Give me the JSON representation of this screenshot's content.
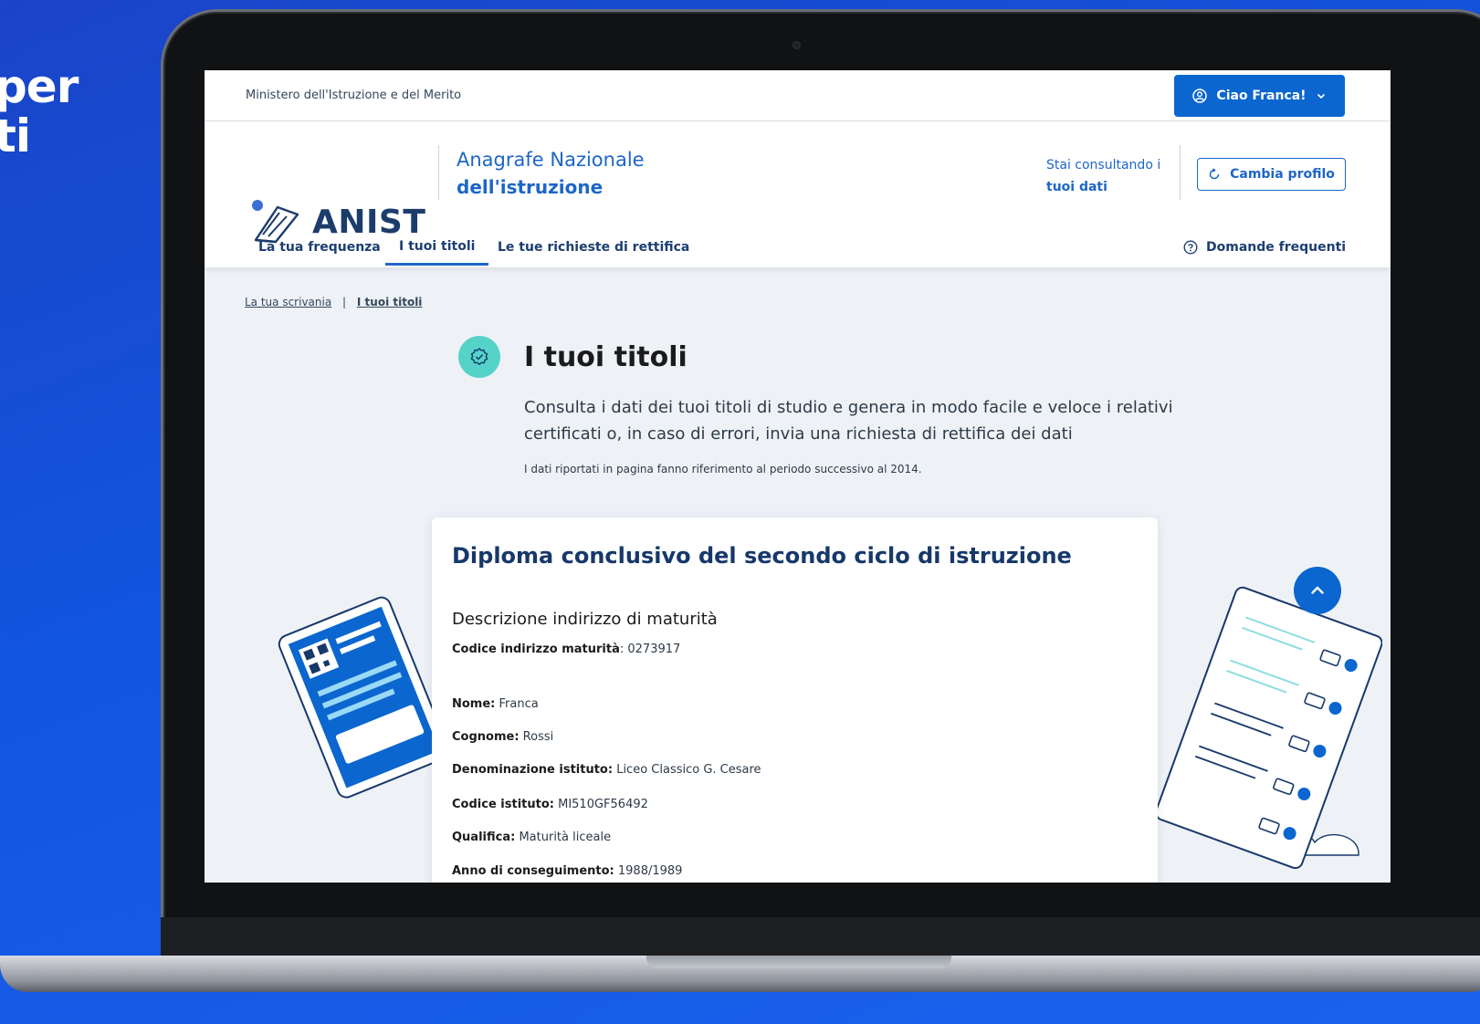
{
  "background": {
    "headline_line1": "per",
    "headline_line2": "ti"
  },
  "topbar": {
    "ministry": "Ministero dell'Istruzione e del Merito",
    "user_greeting": "Ciao Franca!"
  },
  "header": {
    "logo_text": "ANIST",
    "site_title_line1": "Anagrafe Nazionale",
    "site_title_line2": "dell'istruzione",
    "profile_line1": "Stai consultando i",
    "profile_line2": "tuoi dati",
    "change_profile": "Cambia profilo"
  },
  "nav": {
    "items": [
      "La tua frequenza",
      "I tuoi titoli",
      "Le tue richieste di rettifica"
    ],
    "active": "I tuoi titoli",
    "faq": "Domande frequenti"
  },
  "breadcrumb": {
    "home": "La tua scrivania",
    "separator": "|",
    "current": "I tuoi titoli"
  },
  "page": {
    "title": "I tuoi titoli",
    "description": "Consulta i dati dei tuoi titoli di studio e genera in modo facile e veloce i relativi certificati o, in caso di errori, invia una richiesta di rettifica dei dati",
    "note": "I dati riportati in pagina fanno riferimento al periodo successivo al 2014."
  },
  "card": {
    "title": "Diploma conclusivo del secondo ciclo di istruzione",
    "subtitle": "Descrizione indirizzo di maturità",
    "fields": [
      {
        "label": "Codice indirizzo maturità",
        "sep": ": ",
        "value": "0273917"
      },
      {
        "label": "Nome:",
        "sep": " ",
        "value": "Franca"
      },
      {
        "label": "Cognome:",
        "sep": " ",
        "value": "Rossi"
      },
      {
        "label": "Denominazione istituto:",
        "sep": " ",
        "value": "Liceo Classico G. Cesare"
      },
      {
        "label": "Codice istituto:",
        "sep": " ",
        "value": "MI510GF56492"
      },
      {
        "label": "Qualifica:",
        "sep": " ",
        "value": "Maturità liceale"
      },
      {
        "label": "Anno di conseguimento:",
        "sep": " ",
        "value": "1988/1989"
      }
    ]
  },
  "icons": {
    "user": "user-circle-icon",
    "chevron": "chevron-down-icon",
    "refresh": "refresh-icon",
    "help": "help-circle-icon",
    "badge": "verified-badge-icon",
    "arrow_up": "arrow-up-icon"
  },
  "colors": {
    "primary": "#0b66cf",
    "dark_blue": "#17386a",
    "teal": "#55d3c8",
    "page_bg": "#eef2f7"
  }
}
